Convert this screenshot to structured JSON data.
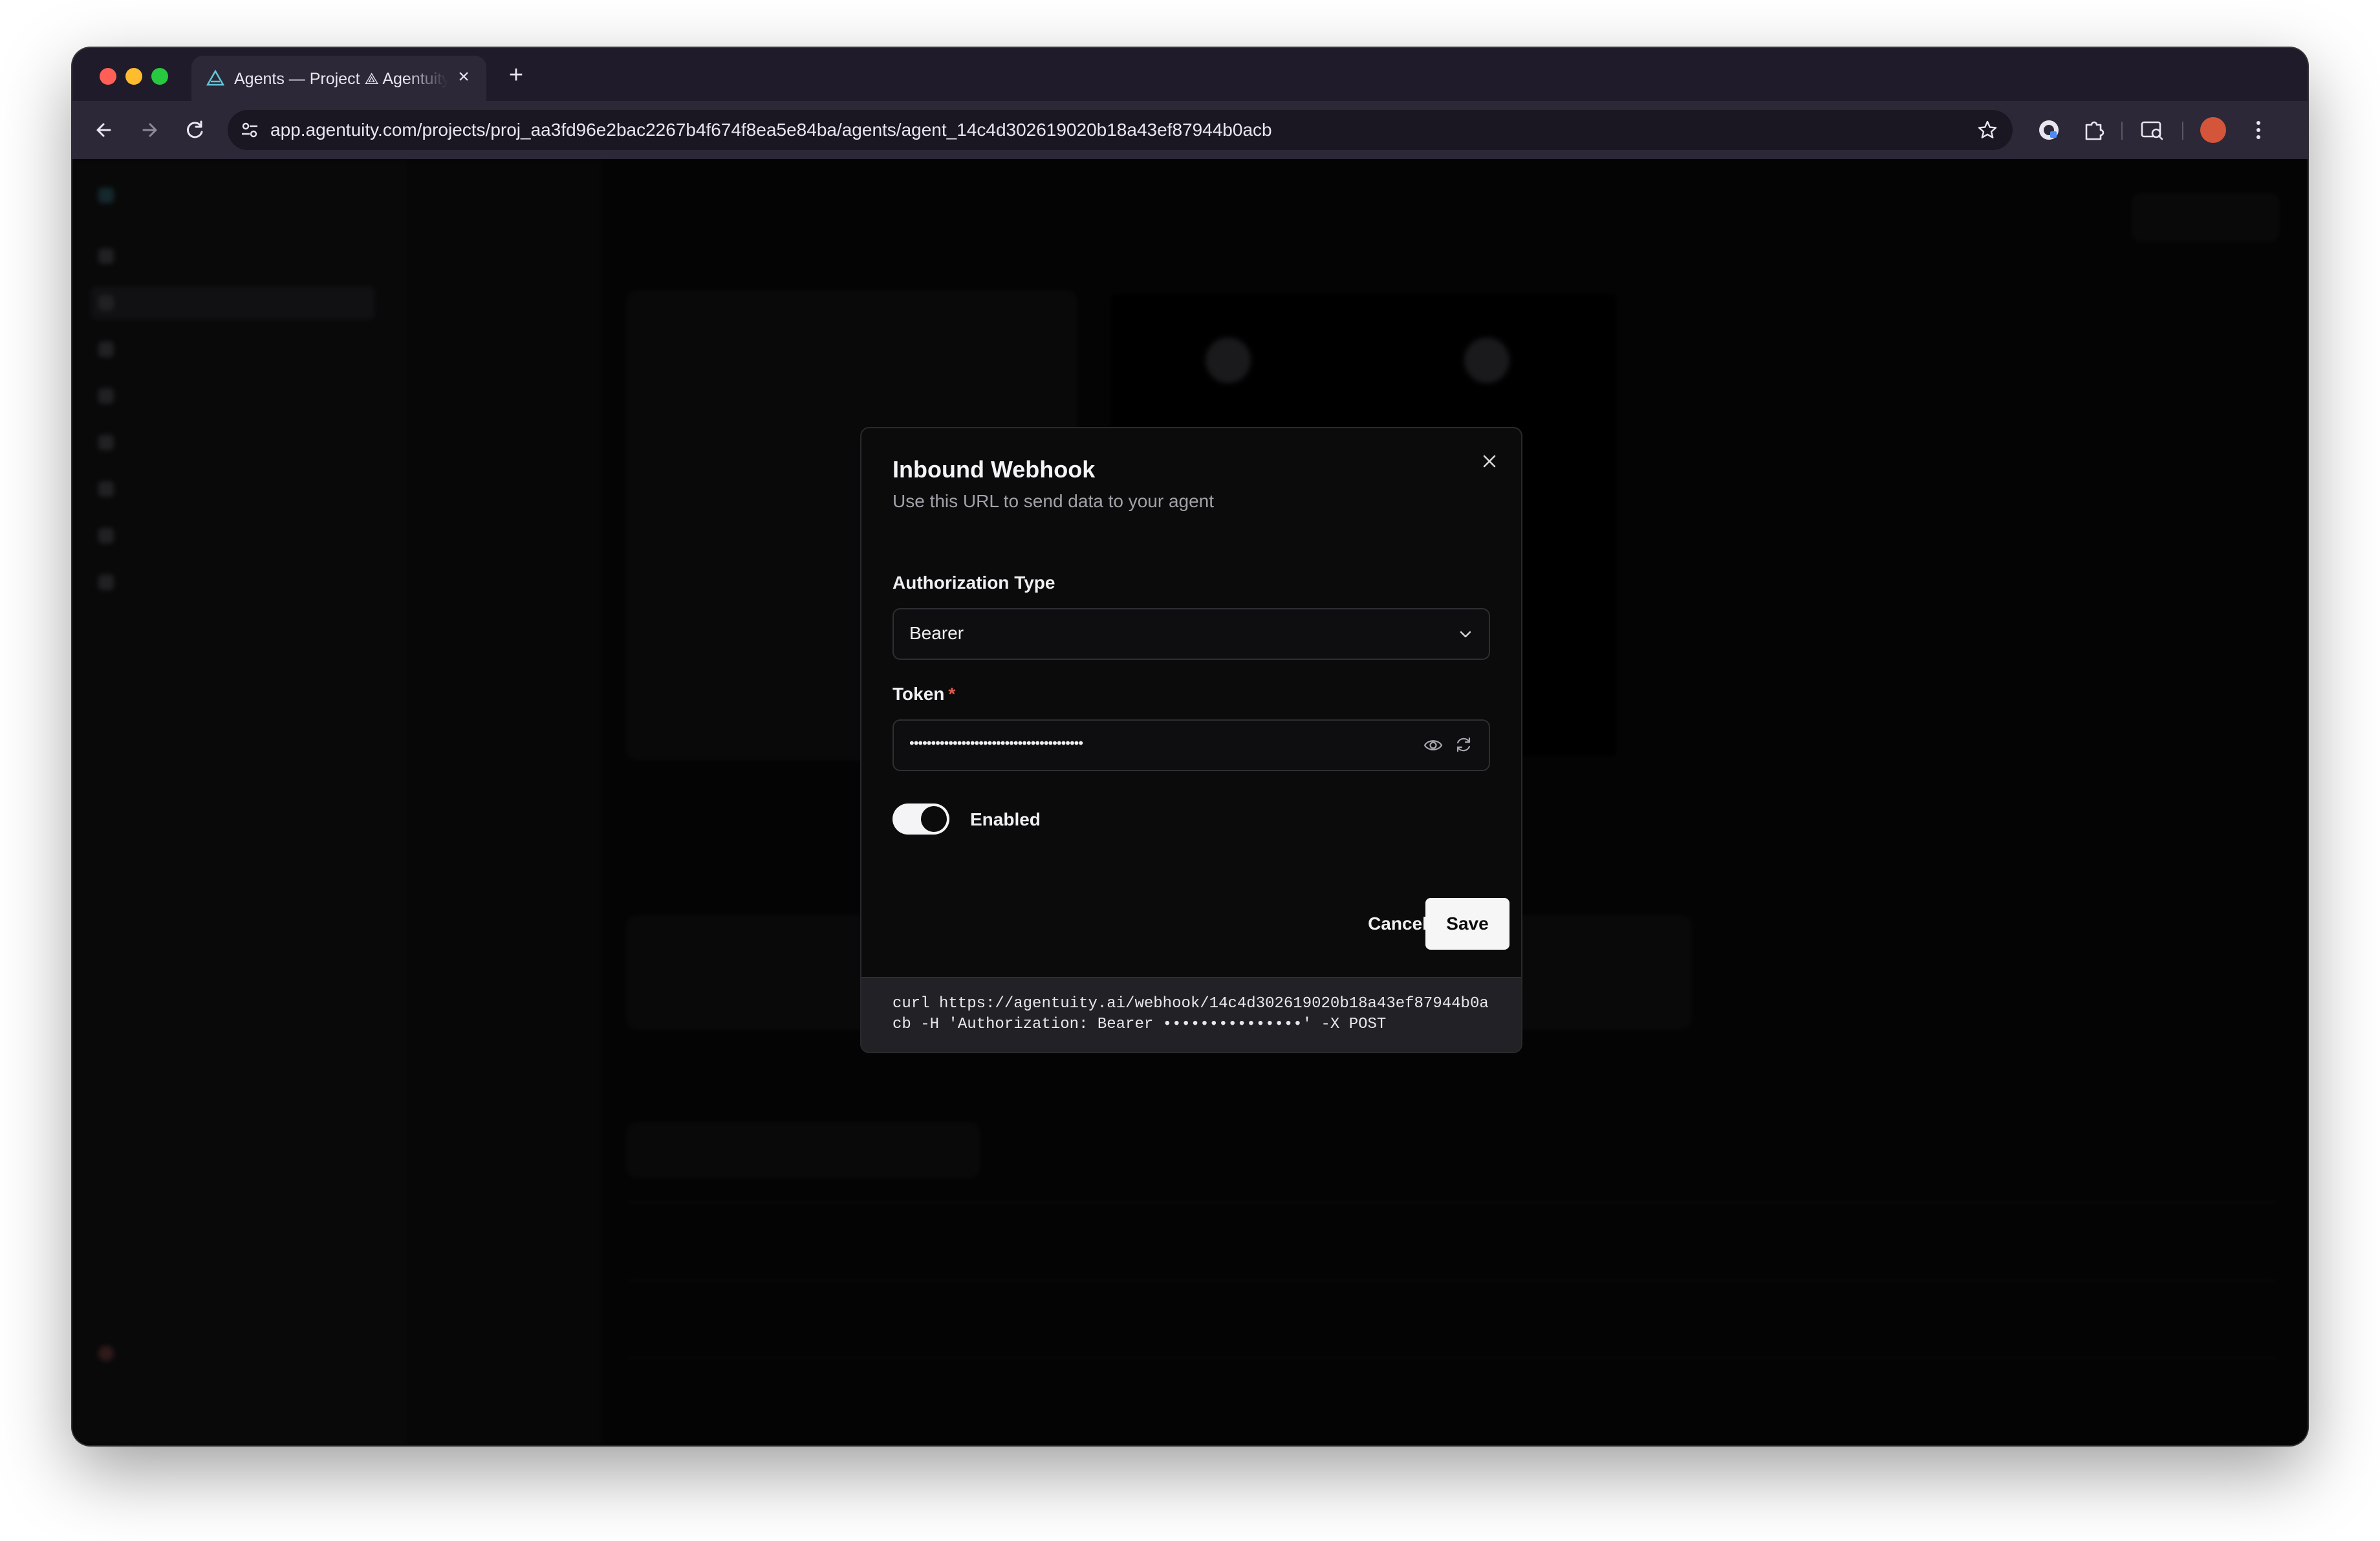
{
  "browser": {
    "tab": {
      "title": "Agents — Project ⟁ Agentuity"
    },
    "address_bar": {
      "url": "app.agentuity.com/projects/proj_aa3fd96e2bac2267b4f674f8ea5e84ba/agents/agent_14c4d302619020b18a43ef87944b0acb"
    }
  },
  "modal": {
    "title": "Inbound Webhook",
    "subtitle": "Use this URL to send data to your agent",
    "authorization_type": {
      "label": "Authorization Type",
      "selected": "Bearer"
    },
    "token": {
      "label": "Token",
      "required_mark": "*",
      "masked_value": "••••••••••••••••••••••••••••••••••••••••"
    },
    "enabled_toggle": {
      "label": "Enabled",
      "on": true
    },
    "buttons": {
      "cancel": "Cancel",
      "save": "Save"
    },
    "curl_example": "curl https://agentuity.ai/webhook/14c4d302619020b18a43ef87944b0acb -H 'Authorization: Bearer •••••••••••••••' -X POST"
  },
  "colors": {
    "modal_bg": "#0b0b0c",
    "overlay": "rgba(0,0,0,0.55)",
    "primary_button": "#f6f6f7",
    "required_asterisk": "#e05a4f"
  },
  "icons": {
    "modal_close": "close-icon",
    "select_chevron": "chevron-down-icon",
    "token_visibility": "eye-icon",
    "token_regenerate": "refresh-icon"
  }
}
